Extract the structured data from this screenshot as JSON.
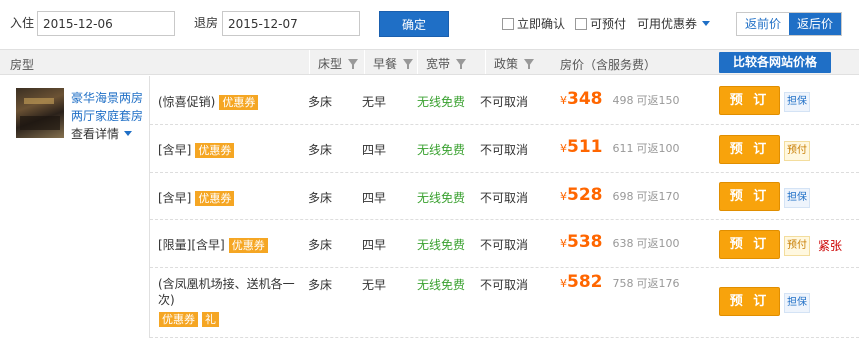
{
  "search": {
    "checkin_label": "入住",
    "checkin_value": "2015-12-06",
    "checkout_label": "退房",
    "checkout_value": "2015-12-07",
    "confirm_label": "确定",
    "filter_instant": "立即确认",
    "filter_prepay": "可预付",
    "filter_coupon": "可用优惠券",
    "sort_prev": "返前价",
    "sort_after": "返后价"
  },
  "table_header": {
    "room_type": "房型",
    "bed": "床型",
    "breakfast": "早餐",
    "broadband": "宽带",
    "policy": "政策",
    "price": "房价（含服务费）",
    "compare_button": "比较各网站价格"
  },
  "room": {
    "name": "豪华海景两房两厅家庭套房",
    "detail_label": "查看详情"
  },
  "rates": [
    {
      "plan": "(惊喜促销)",
      "tags": [
        "优惠券"
      ],
      "bed": "多床",
      "breakfast": "无早",
      "broadband": "无线免费",
      "policy": "不可取消",
      "currency": "¥",
      "price": "348",
      "original": "498",
      "rebate": "可返150",
      "book_label": "预 订",
      "badge": "担保",
      "badge_type": "guarantee",
      "extra": ""
    },
    {
      "plan": "[含早]",
      "tags": [
        "优惠券"
      ],
      "bed": "多床",
      "breakfast": "四早",
      "broadband": "无线免费",
      "policy": "不可取消",
      "currency": "¥",
      "price": "511",
      "original": "611",
      "rebate": "可返100",
      "book_label": "预 订",
      "badge": "预付",
      "badge_type": "prepay",
      "extra": ""
    },
    {
      "plan": "[含早]",
      "tags": [
        "优惠券"
      ],
      "bed": "多床",
      "breakfast": "四早",
      "broadband": "无线免费",
      "policy": "不可取消",
      "currency": "¥",
      "price": "528",
      "original": "698",
      "rebate": "可返170",
      "book_label": "预 订",
      "badge": "担保",
      "badge_type": "guarantee",
      "extra": ""
    },
    {
      "plan": "[限量][含早]",
      "tags": [
        "优惠券"
      ],
      "bed": "多床",
      "breakfast": "四早",
      "broadband": "无线免费",
      "policy": "不可取消",
      "currency": "¥",
      "price": "538",
      "original": "638",
      "rebate": "可返100",
      "book_label": "预 订",
      "badge": "预付",
      "badge_type": "prepay",
      "extra": "紧张"
    },
    {
      "plan": "(含凤凰机场接、送机各一次)",
      "tags": [
        "优惠券",
        "礼"
      ],
      "bed": "多床",
      "breakfast": "无早",
      "broadband": "无线免费",
      "policy": "不可取消",
      "currency": "¥",
      "price": "582",
      "original": "758",
      "rebate": "可返176",
      "book_label": "预 订",
      "badge": "担保",
      "badge_type": "guarantee",
      "extra": ""
    }
  ]
}
